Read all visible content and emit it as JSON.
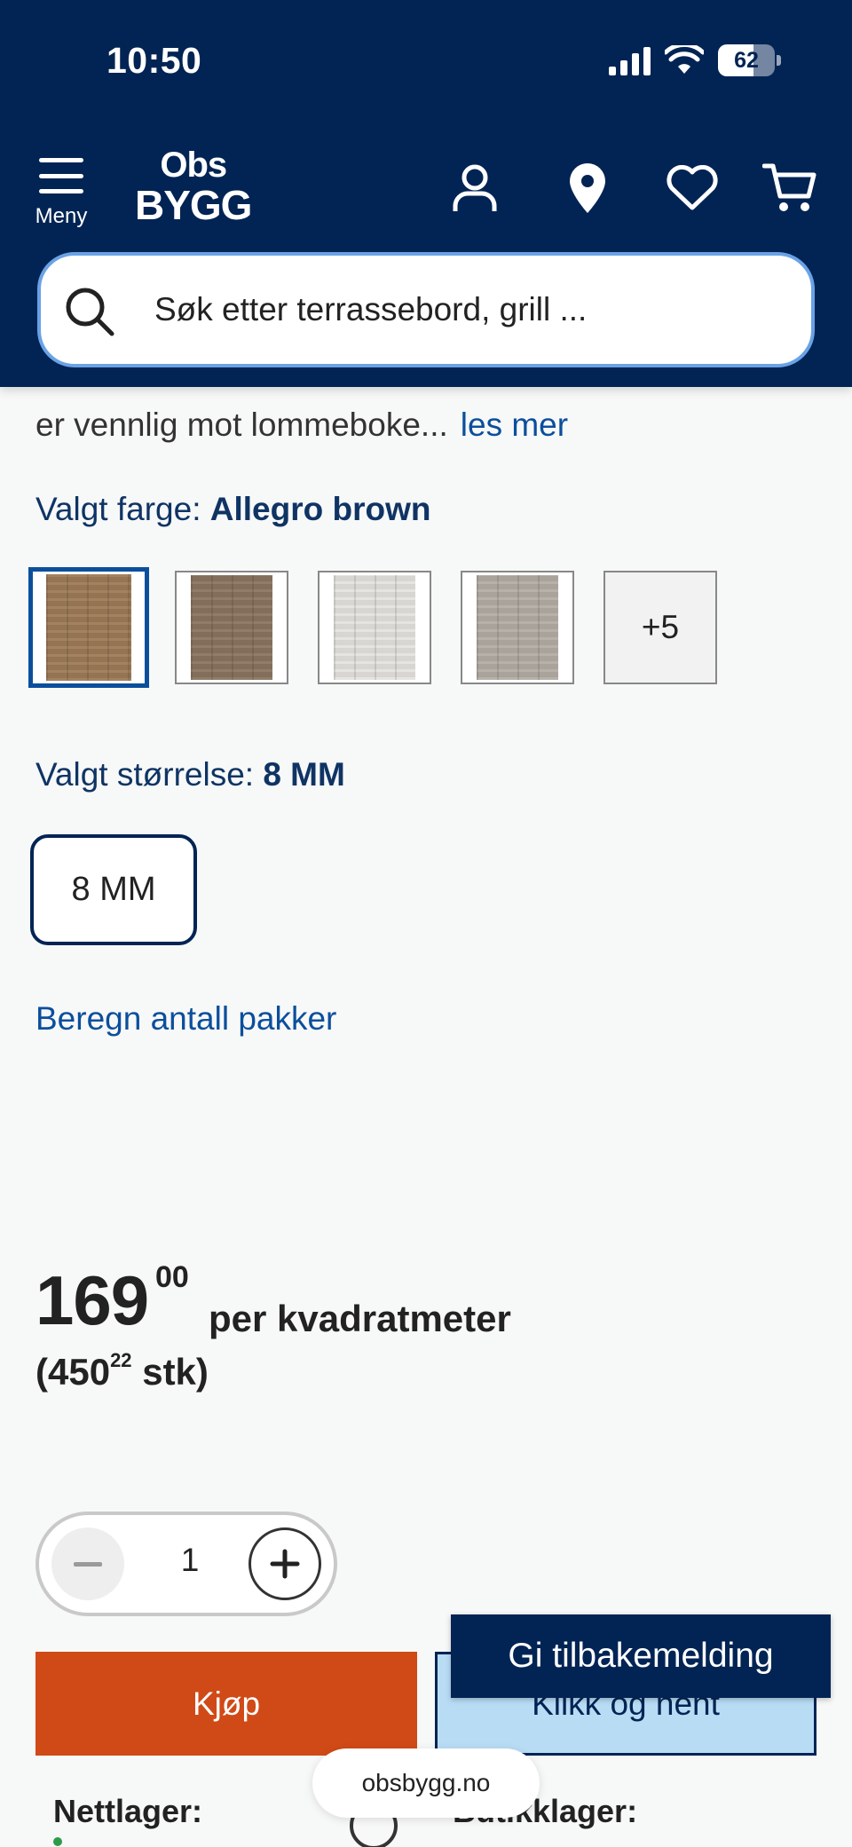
{
  "status_bar": {
    "time": "10:50",
    "battery": "62",
    "battery_level": 0.62
  },
  "header": {
    "menu_label": "Meny",
    "logo_line1": "Obs",
    "logo_line2": "BYGG",
    "icons": [
      "user-icon",
      "location-pin-icon",
      "heart-icon",
      "cart-icon"
    ],
    "search_placeholder": "Søk etter terrassebord, grill ..."
  },
  "product": {
    "description_cut": "er vennlig mot lommeboke...",
    "read_more": "les mer",
    "color_label": "Valgt farge:",
    "color_value": "Allegro brown",
    "color_swatches": [
      {
        "name": "Allegro brown",
        "color": "#9c7a56",
        "selected": true
      },
      {
        "name": "swatch-2",
        "color": "#8a7460",
        "selected": false
      },
      {
        "name": "swatch-3",
        "color": "#e4e2dd",
        "selected": false
      },
      {
        "name": "swatch-4",
        "color": "#b3aca4",
        "selected": false
      }
    ],
    "more_colors": "+5",
    "size_label": "Valgt størrelse:",
    "size_value": "8 MM",
    "size_option": "8 MM",
    "calc_link": "Beregn antall pakker",
    "price_main": "169",
    "price_decimals": "00",
    "price_unit": "per kvadratmeter",
    "price_piece_open": "(450",
    "price_piece_decimals": "22",
    "price_piece_close": " stk)",
    "quantity": "1",
    "buy_label": "Kjøp",
    "pickup_label": "Klikk og hent",
    "feedback_label": "Gi tilbakemelding",
    "online_stock_label": "Nettlager:",
    "store_stock_label": "Butikklager:"
  },
  "browser": {
    "url": "obsbygg.no"
  },
  "colors": {
    "header_bg": "#022454",
    "buy": "#d04a17",
    "pickup": "#b9dcf5",
    "link": "#0b4f9c"
  }
}
